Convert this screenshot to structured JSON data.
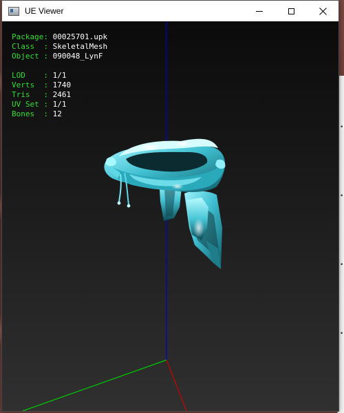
{
  "window": {
    "title": "UE Viewer",
    "icon": "app-icon",
    "controls": [
      "minimize-icon",
      "maximize-icon",
      "close-icon"
    ]
  },
  "info": {
    "package_label": "Package: ",
    "package": "00025701.upk",
    "class_label": "Class  : ",
    "class": "SkeletalMesh",
    "object_label": "Object : ",
    "object": "090048_LynF",
    "lod_label": "LOD    : ",
    "lod": "1/1",
    "verts_label": "Verts  : ",
    "verts": "1740",
    "tris_label": "Tris   : ",
    "tris": "2461",
    "uvset_label": "UV Set : ",
    "uvset": "1/1",
    "bones_label": "Bones  : ",
    "bones": "12"
  },
  "colors": {
    "label": "#33dd33",
    "value": "#ffffff",
    "axis_x": "#cc0000",
    "axis_y": "#00cc00",
    "axis_z": "#0000cc",
    "mesh": "#5fd8e6"
  }
}
